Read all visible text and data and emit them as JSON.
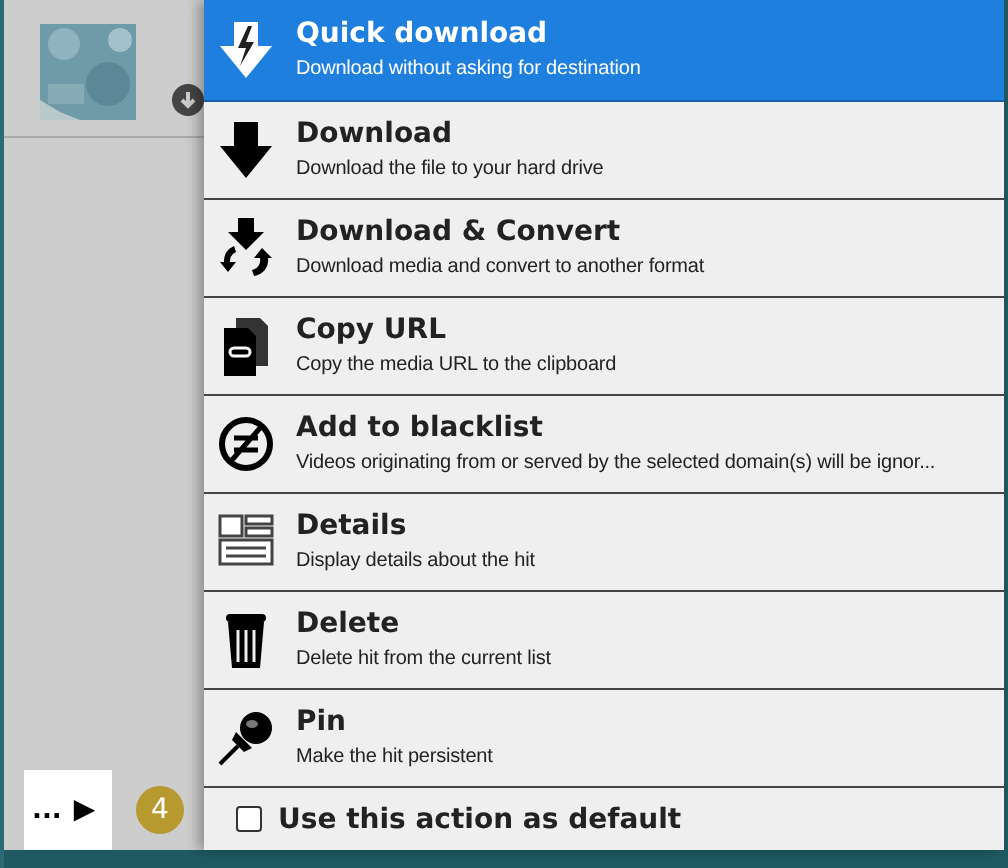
{
  "panel": {
    "badge": "4",
    "more": "...",
    "play": "▶"
  },
  "menu": {
    "items": [
      {
        "kind": "quick",
        "title": "Quick download",
        "description": "Download without asking for destination",
        "selected": true
      },
      {
        "kind": "download",
        "title": "Download",
        "description": "Download the file to your hard drive",
        "selected": false
      },
      {
        "kind": "convert",
        "title": "Download & Convert",
        "description": "Download media and convert to another format",
        "selected": false
      },
      {
        "kind": "copy",
        "title": "Copy URL",
        "description": "Copy the media URL to the clipboard",
        "selected": false
      },
      {
        "kind": "block",
        "title": "Add to blacklist",
        "description": "Videos originating from or served by the selected domain(s) will be ignor...",
        "selected": false
      },
      {
        "kind": "details",
        "title": "Details",
        "description": "Display details about the hit",
        "selected": false
      },
      {
        "kind": "delete",
        "title": "Delete",
        "description": "Delete hit from the current list",
        "selected": false
      },
      {
        "kind": "pin",
        "title": "Pin",
        "description": "Make the hit persistent",
        "selected": false
      }
    ],
    "default_option": {
      "label": "Use this action as default",
      "checked": false
    }
  }
}
